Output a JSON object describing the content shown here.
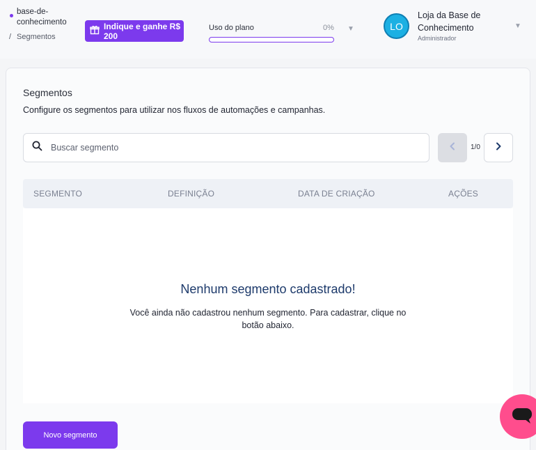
{
  "breadcrumb": {
    "store": "base-de-conhecimento",
    "separator": "/",
    "page": "Segmentos"
  },
  "refer": {
    "label": "Indique e ganhe R$ 200"
  },
  "plan": {
    "label": "Uso do plano",
    "percent_text": "0%",
    "usage_fraction": 0
  },
  "user": {
    "initials": "LO",
    "name": "Loja da Base de Conhecimento",
    "role": "Administrador"
  },
  "page": {
    "title": "Segmentos",
    "description": "Configure os segmentos para utilizar nos fluxos de automações e campanhas."
  },
  "search": {
    "placeholder": "Buscar segmento",
    "value": ""
  },
  "pagination": {
    "label": "1/0"
  },
  "table": {
    "columns": [
      "SEGMENTO",
      "DEFINIÇÃO",
      "DATA DE CRIAÇÃO",
      "AÇÕES"
    ]
  },
  "empty": {
    "title": "Nenhum segmento cadastrado!",
    "description": "Você ainda não cadastrou nenhum segmento. Para cadastrar, clique no botão abaixo."
  },
  "actions": {
    "new_label": "Novo segmento"
  },
  "colors": {
    "brand": "#7c3aed",
    "avatar": "#1cb0e3",
    "chat": "#ff4d8d",
    "empty_title": "#1d3a6b"
  },
  "icons": {
    "search": "search-icon",
    "gift": "gift-icon",
    "prev": "chevron-left-icon",
    "next": "chevron-right-icon",
    "chat": "chat-icon",
    "caret": "caret-down-icon"
  }
}
